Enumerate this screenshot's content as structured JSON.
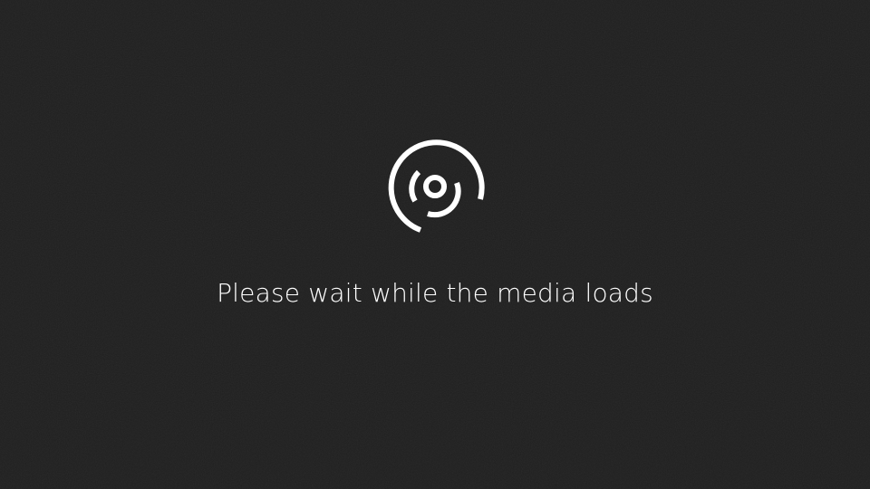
{
  "loader": {
    "icon": "media-loading-spinner-icon",
    "message": "Please wait while the media loads"
  },
  "colors": {
    "background": "#1f1f1f",
    "foreground": "#ffffff"
  }
}
